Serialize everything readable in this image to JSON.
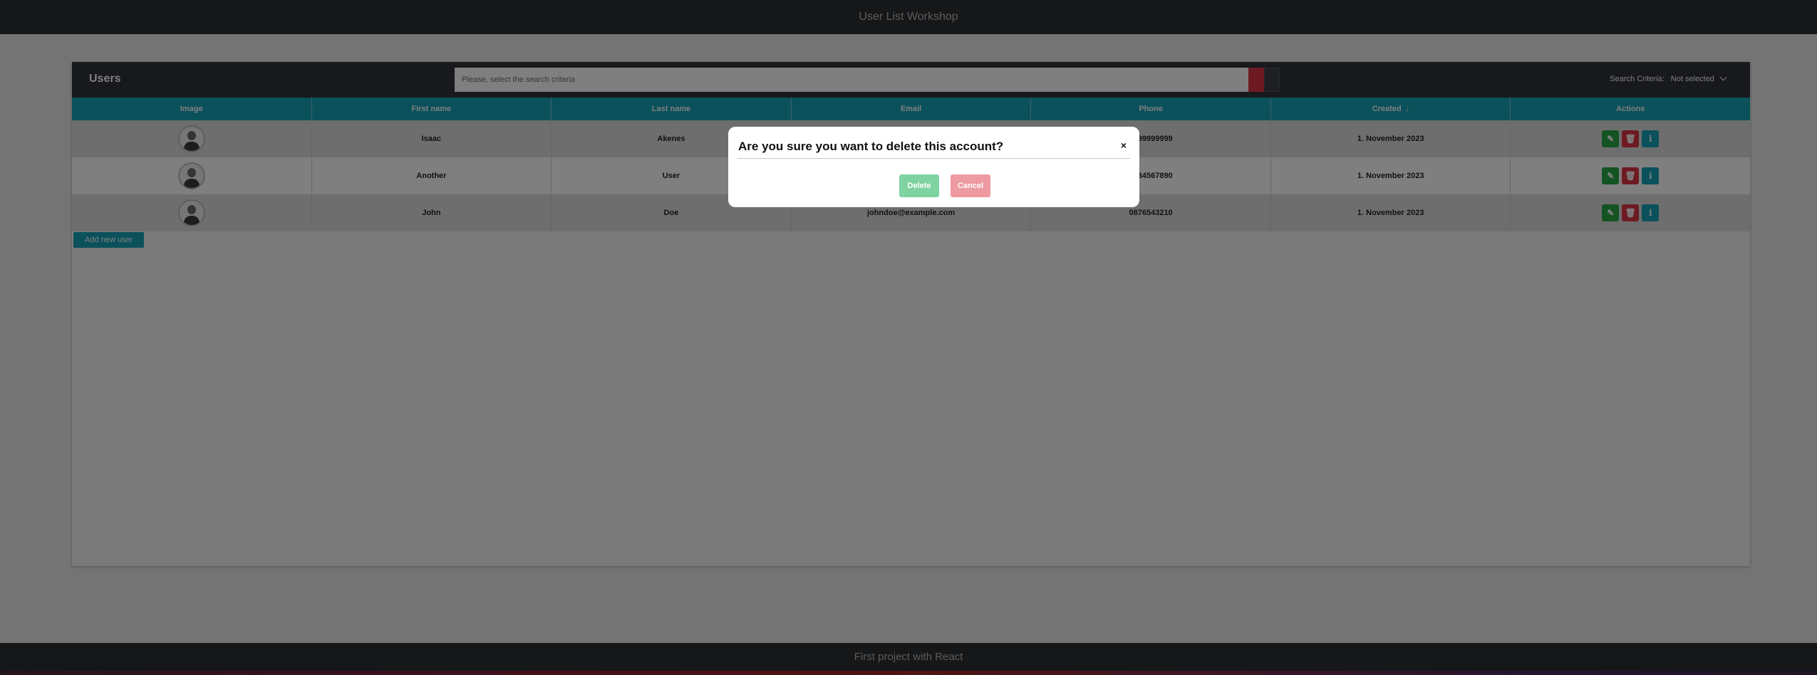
{
  "header": {
    "title": "User List Workshop"
  },
  "panel": {
    "title": "Users",
    "search": {
      "placeholder": "Please, select the search criteria"
    },
    "criteria": {
      "label": "Search Criteria:",
      "selected": "Not selected"
    }
  },
  "table": {
    "columns": [
      "Image",
      "First name",
      "Last name",
      "Email",
      "Phone",
      "Created"
    ],
    "actions_label": "Actions",
    "sort_indicator": "↓",
    "rows": [
      {
        "first": "Isaac",
        "last": "Akenes",
        "email": "",
        "phone": "9999999999",
        "created": "1. November 2023"
      },
      {
        "first": "Another",
        "last": "User",
        "email": "",
        "phone": "1234567890",
        "created": "1. November 2023"
      },
      {
        "first": "John",
        "last": "Doe",
        "email": "johndoe@example.com",
        "phone": "0876543210",
        "created": "1. November 2023"
      }
    ]
  },
  "add_button": "Add new user",
  "footer": {
    "text": "First project with React"
  },
  "modal": {
    "title": "Are you sure you want to delete this account?",
    "close": "×",
    "delete_label": "Delete",
    "cancel_label": "Cancel"
  },
  "colors": {
    "accent": "#17a2b8",
    "danger": "#dc3545",
    "success": "#28a745",
    "header_bg": "#2a2e33"
  }
}
